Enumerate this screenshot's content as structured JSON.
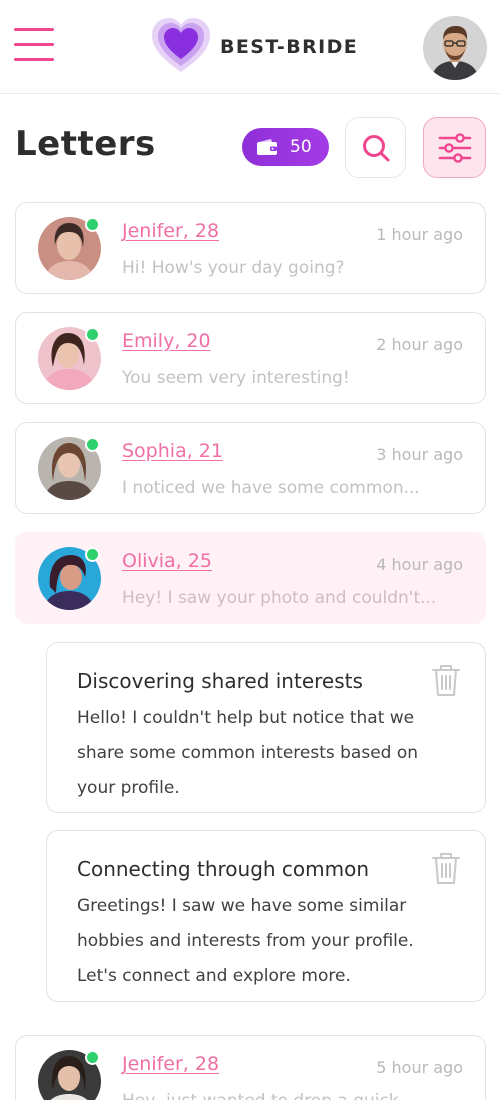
{
  "header": {
    "brand": "BEST-BRIDE",
    "menu_icon": "hamburger-menu-icon",
    "logo_icon": "heart-logo-icon",
    "accent": "#f0468f"
  },
  "toolbar": {
    "title": "Letters",
    "credits": "50",
    "wallet_icon": "wallet-icon",
    "search_icon": "search-icon",
    "filter_icon": "filter-sliders-icon"
  },
  "letters": [
    {
      "name": "Jenifer, 28",
      "time": "1 hour ago",
      "preview": "Hi! How's your day going?",
      "online": true
    },
    {
      "name": "Emily, 20",
      "time": "2 hour ago",
      "preview": "You seem very interesting!",
      "online": true
    },
    {
      "name": "Sophia, 21",
      "time": "3 hour ago",
      "preview": " I noticed we have some common...",
      "online": true
    },
    {
      "name": "Olivia, 25",
      "time": "4 hour ago",
      "preview": "Hey! I saw your photo and couldn't...",
      "online": true,
      "active": true
    },
    {
      "name": "Jenifer, 28",
      "time": "5 hour ago",
      "preview": "Hey, just wanted to drop a quick...",
      "online": true
    }
  ],
  "sub_letters": [
    {
      "subject": "Discovering shared interests",
      "body": "Hello! I couldn't help but notice that we share some common interests based on your profile."
    },
    {
      "subject": "Connecting through common",
      "body": "Greetings! I saw we have some similar hobbies and interests from your profile. Let's connect and explore more."
    }
  ],
  "colors": {
    "name_link": "#f06fa5",
    "online": "#2ed16b",
    "credits_bg": "#9a35df",
    "active_card": "#fff1f5"
  }
}
